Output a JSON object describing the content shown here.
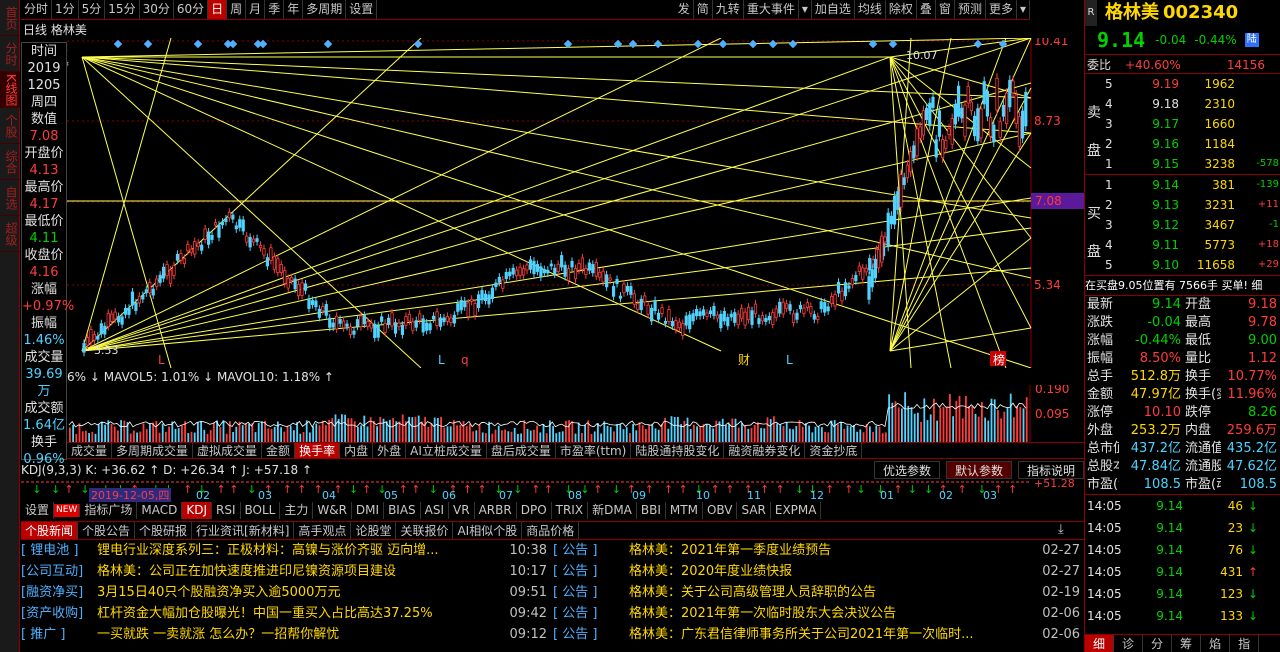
{
  "sidebar": [
    "首页",
    "分时图",
    "K线图",
    "个股资料",
    "综合排名",
    "自选股",
    "超级盘口"
  ],
  "toolbar": {
    "left": [
      "分时",
      "1分",
      "5分",
      "15分",
      "30分",
      "60分",
      "日",
      "周",
      "月",
      "季",
      "年",
      "多周期",
      "设置"
    ],
    "right": [
      "发",
      "简",
      "九转",
      "重大事件",
      "▾",
      "加自选",
      "均线",
      "除权",
      "叠",
      "窗",
      "预测",
      "更多",
      "▾"
    ]
  },
  "chart": {
    "title": "日线  格林美",
    "price_labels": [
      "10.41",
      "8.73",
      "7.08",
      "5.34"
    ],
    "current_price_tag": "7.08",
    "high_label": "10.07",
    "low_label": "3.53",
    "markers": [
      "L",
      "L",
      "q",
      "财",
      "L",
      "榜"
    ]
  },
  "info": {
    "labels": [
      [
        "时间",
        "2019"
      ],
      [
        "",
        "1205"
      ],
      [
        "",
        "周四"
      ],
      [
        "数值",
        "7.08"
      ],
      [
        "开盘价",
        "4.13"
      ],
      [
        "最高价",
        "4.17"
      ],
      [
        "最低价",
        "4.11"
      ],
      [
        "收盘价",
        "4.16"
      ],
      [
        "涨幅",
        "+0.97%"
      ],
      [
        "振幅",
        "1.46%"
      ],
      [
        "成交量",
        "39.69万"
      ],
      [
        "成交额",
        "1.64亿"
      ],
      [
        "换手",
        "0.96%"
      ]
    ]
  },
  "volume": {
    "legend": "6% ↓  MAVOL5: 1.01% ↓  MAVOL10: 1.18% ↑",
    "ticks": [
      "0.190",
      "0.095"
    ]
  },
  "indicator_tabs": [
    "成交量",
    "多周期成交量",
    "虚拟成交量",
    "金额",
    "换手率",
    "内盘",
    "外盘",
    "AI立桩成交量",
    "盘后成交量",
    "市盈率(ttm)",
    "陆股通持股变化",
    "融资融券变化",
    "资金抄底"
  ],
  "indicator_tab_selected": "换手率",
  "kdj": {
    "legend": "KDJ(9,3,3)  K: +36.62 ↑  D: +26.34 ↑  J: +57.18 ↑",
    "buttons": [
      "优选参数",
      "默认参数",
      "指标说明"
    ],
    "value": "+51.28",
    "date_tag": "2019-12-05,四",
    "months": [
      "02",
      "03",
      "04",
      "05",
      "06",
      "07",
      "08",
      "09",
      "10",
      "11",
      "12",
      "01",
      "02",
      "03"
    ]
  },
  "indicators": [
    "设置",
    "指标广场",
    "MACD",
    "KDJ",
    "RSI",
    "BOLL",
    "主力",
    "W&R",
    "DMI",
    "BIAS",
    "ASI",
    "VR",
    "ARBR",
    "DPO",
    "TRIX",
    "新DMA",
    "BBI",
    "MTM",
    "OBV",
    "SAR",
    "EXPMA"
  ],
  "indicator_selected": "KDJ",
  "news_tabs": [
    "个股新闻",
    "个股公告",
    "个股研报",
    "行业资讯[新材料]",
    "高手观点",
    "论股堂",
    "关联报价",
    "AI相似个股",
    "商品价格"
  ],
  "news_left": [
    [
      "[ 锂电池 ]",
      "锂电行业深度系列三：正极材料：高镍与涨价齐驱 迈向增...",
      "10:38"
    ],
    [
      "[公司互动]",
      "格林美：公司正在加快速度推进印尼镍资源项目建设",
      "10:17"
    ],
    [
      "[融资净买]",
      "3月15日40只个股融资净买入逾5000万元",
      "09:51"
    ],
    [
      "[资产收购]",
      "杠杆资金大幅加仓股曝光！中国一重买入占比高达37.25%",
      "09:42"
    ],
    [
      "[ 推广 ]",
      "一买就跌 一卖就涨 怎么办？一招帮你解忧",
      "09:12"
    ]
  ],
  "news_right": [
    [
      "[ 公告 ]",
      "格林美：2021年第一季度业绩预告",
      "02-27"
    ],
    [
      "[ 公告 ]",
      "格林美：2020年度业绩快报",
      "02-27"
    ],
    [
      "[ 公告 ]",
      "格林美：关于公司高级管理人员辞职的公告",
      "02-19"
    ],
    [
      "[ 公告 ]",
      "格林美：2021年第一次临时股东大会决议公告",
      "02-06"
    ],
    [
      "[ 公告 ]",
      "格林美：广东君信律师事务所关于公司2021年第一次临时...",
      "02-06"
    ]
  ],
  "quote": {
    "name": "格林美",
    "code": "002340",
    "price": "9.14",
    "change": "-0.04",
    "pct": "-0.44%",
    "weibi_label": "委比",
    "weibi": "+40.60%",
    "weicha": "14156",
    "sell": [
      [
        "5",
        "9.19",
        "1962",
        ""
      ],
      [
        "4",
        "9.18",
        "2310",
        ""
      ],
      [
        "3",
        "9.17",
        "1660",
        ""
      ],
      [
        "2",
        "9.16",
        "1184",
        ""
      ],
      [
        "1",
        "9.15",
        "3238",
        "-578"
      ]
    ],
    "buy": [
      [
        "1",
        "9.14",
        "381",
        "-139"
      ],
      [
        "2",
        "9.13",
        "3231",
        "+11"
      ],
      [
        "3",
        "9.12",
        "3467",
        "-1"
      ],
      [
        "4",
        "9.11",
        "5773",
        "+18"
      ],
      [
        "5",
        "9.10",
        "11658",
        "+29"
      ]
    ],
    "notice": "在买盘9.05位置有 7566手 买单! 细",
    "stats": [
      [
        "最新",
        "9.14",
        "开盘",
        "9.18"
      ],
      [
        "涨跌",
        "-0.04",
        "最高",
        "9.78"
      ],
      [
        "涨幅",
        "-0.44%",
        "最低",
        "9.00"
      ],
      [
        "振幅",
        "8.50%",
        "量比",
        "1.12"
      ],
      [
        "总手",
        "512.8万",
        "换手",
        "10.77%"
      ],
      [
        "金额",
        "47.97亿",
        "换手(实)",
        "11.96%"
      ],
      [
        "涨停",
        "10.10",
        "跌停",
        "8.26"
      ],
      [
        "外盘",
        "253.2万",
        "内盘",
        "259.6万"
      ],
      [
        "总市值",
        "437.2亿",
        "流通值",
        "435.2亿"
      ],
      [
        "总股本",
        "47.84亿",
        "流通股",
        "47.62亿"
      ],
      [
        "市盈(静)",
        "108.5",
        "市盈(动)",
        "108.5"
      ]
    ],
    "ticks": [
      [
        "14:05",
        "9.14",
        "46",
        "↓"
      ],
      [
        "14:05",
        "9.14",
        "23",
        "↓"
      ],
      [
        "14:05",
        "9.14",
        "76",
        "↓"
      ],
      [
        "14:05",
        "9.14",
        "431",
        "↑"
      ],
      [
        "14:05",
        "9.14",
        "123",
        "↓"
      ],
      [
        "14:05",
        "9.14",
        "133",
        "↓"
      ]
    ],
    "bottom_tabs": [
      "细",
      "诊",
      "分",
      "筹",
      "焰",
      "指"
    ]
  }
}
